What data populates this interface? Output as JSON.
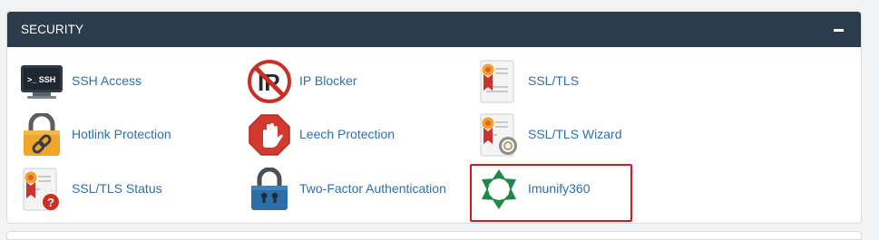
{
  "panel": {
    "title": "SECURITY",
    "collapse_symbol": "−"
  },
  "items": [
    {
      "label": "SSH Access",
      "icon": "terminal-ssh-icon",
      "icon_text": ">_ SSH"
    },
    {
      "label": "IP Blocker",
      "icon": "ip-blocker-icon",
      "icon_text": "IP"
    },
    {
      "label": "SSL/TLS",
      "icon": "certificate-icon"
    },
    {
      "label": "Hotlink Protection",
      "icon": "padlock-chain-icon"
    },
    {
      "label": "Leech Protection",
      "icon": "stop-hand-icon"
    },
    {
      "label": "SSL/TLS Wizard",
      "icon": "certificate-wizard-icon"
    },
    {
      "label": "SSL/TLS Status",
      "icon": "certificate-status-icon",
      "icon_text": "?"
    },
    {
      "label": "Two-Factor Authentication",
      "icon": "lock-keypad-icon"
    },
    {
      "label": "Imunify360",
      "icon": "imunify360-logo-icon"
    }
  ],
  "colors": {
    "header_bg": "#2b3c4d",
    "link": "#2f6eb0",
    "highlight_border": "#d9141d"
  }
}
